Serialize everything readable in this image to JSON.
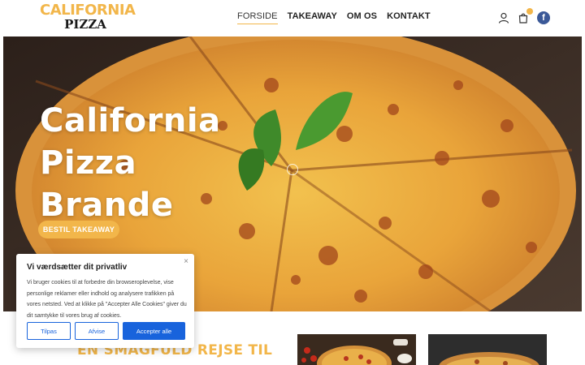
{
  "header": {
    "logo_top": "CALIFORNIA",
    "logo_bottom": "PIZZA",
    "nav": [
      {
        "label": "FORSIDE",
        "active": true
      },
      {
        "label": "TAKEAWAY"
      },
      {
        "label": "OM OS"
      },
      {
        "label": "KONTAKT"
      }
    ],
    "icons": [
      "user-icon",
      "cart-icon",
      "facebook-icon"
    ],
    "facebook_letter": "f"
  },
  "hero": {
    "title_lines": [
      "California",
      "Pizza",
      "Brande"
    ],
    "cta_label": "BESTIL TAKEAWAY"
  },
  "section": {
    "heading": "EN SMAGFULD REJSE TIL"
  },
  "cookie": {
    "title": "Vi værdsætter dit privatliv",
    "close": "×",
    "text": "Vi bruger cookies til at forbedre din browseroplevelse, vise personlige reklamer eller indhold og analysere trafikken på vores netsted. Ved at klikke på \"Accepter Alle Cookies\" giver du dit samtykke til vores brug af cookies.",
    "buttons": {
      "customize": "Tilpas",
      "reject": "Afvise",
      "accept_all": "Accepter alle"
    }
  },
  "colors": {
    "accent": "#f2b64a",
    "cookie_blue": "#1863dc",
    "facebook": "#3b5998"
  }
}
